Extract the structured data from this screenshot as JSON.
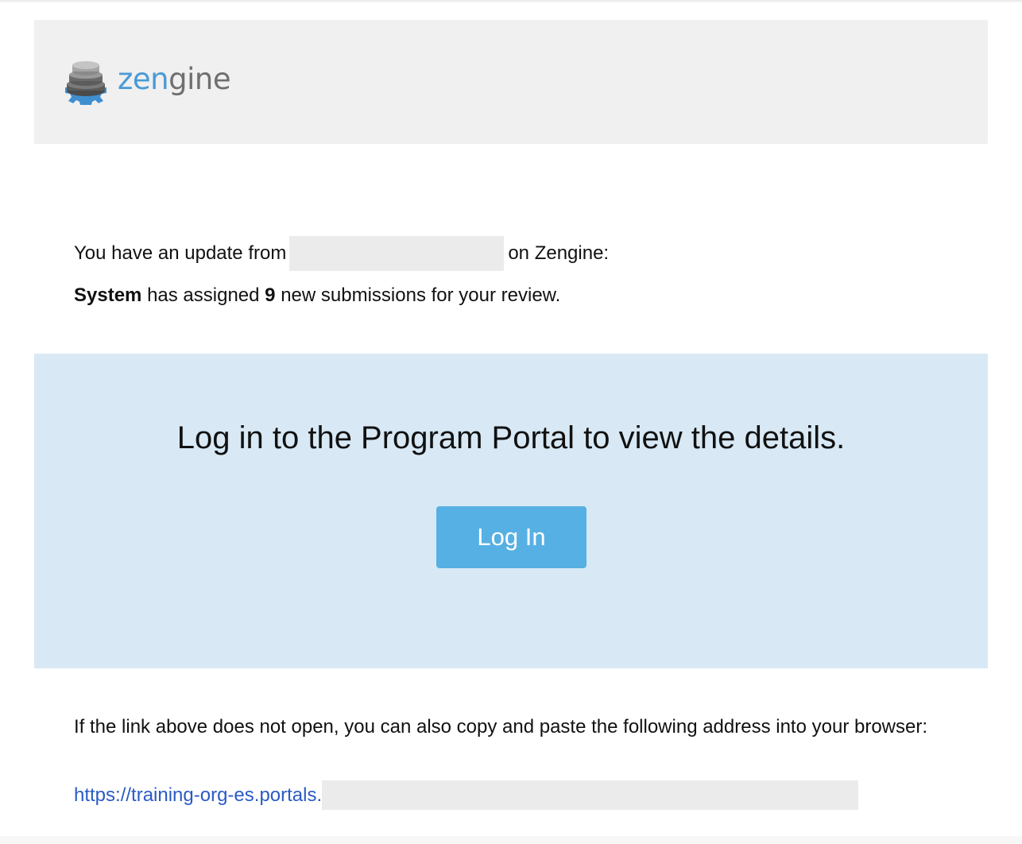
{
  "brand": {
    "logo_zen": "zen",
    "logo_gine": "gine"
  },
  "message": {
    "update_prefix": "You have an update from",
    "update_suffix": "on Zengine:",
    "assigner": "System",
    "assign_mid": "has assigned",
    "count": "9",
    "assign_suffix": "new submissions for your review."
  },
  "cta": {
    "title": "Log in to the Program Portal to view the details.",
    "button_label": "Log In"
  },
  "fallback": {
    "text": "If the link above does not open, you can also copy and paste the following address into your browser:",
    "link_visible": "https://training-org-es.portals."
  },
  "colors": {
    "brand_blue": "#4a9ad6",
    "button": "#57b0e3",
    "cta_background": "#d8e9f5",
    "link": "#2a5bc4"
  }
}
